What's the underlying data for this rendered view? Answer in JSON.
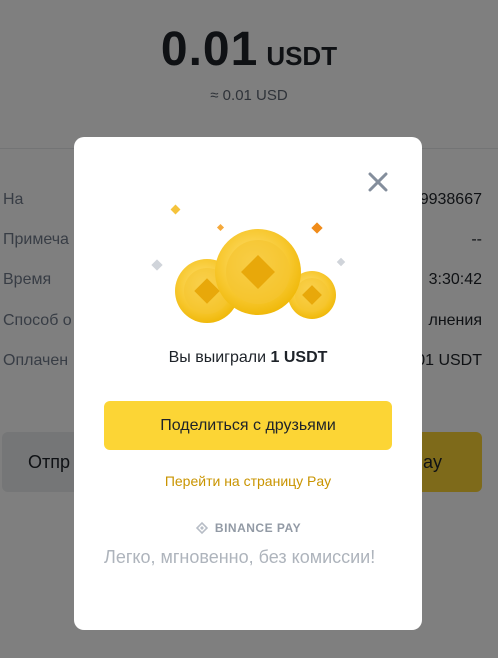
{
  "receipt": {
    "amount": "0.01",
    "currency": "USDT",
    "approx": "≈ 0.01 USD"
  },
  "details": [
    {
      "label": "На",
      "value": "9938667"
    },
    {
      "label": "Примеча",
      "value": "--"
    },
    {
      "label": "Время",
      "value": "3:30:42"
    },
    {
      "label": "Способ о",
      "value": "лнения"
    },
    {
      "label": "Оплачен",
      "value": "01 USDT"
    }
  ],
  "bottom": {
    "send_label": "Отпр",
    "pay_label": "ay"
  },
  "modal": {
    "win_prefix": "Вы выиграли",
    "win_amount": "1 USDT",
    "share_button": "Поделиться с друзьями",
    "pay_link": "Перейти на страницу Pay",
    "brand": "BINANCE PAY",
    "tagline": "Легко, мгновенно, без комиссии!",
    "close_icon": "close-icon",
    "accent": "#fcd535",
    "link_color": "#c99400"
  }
}
